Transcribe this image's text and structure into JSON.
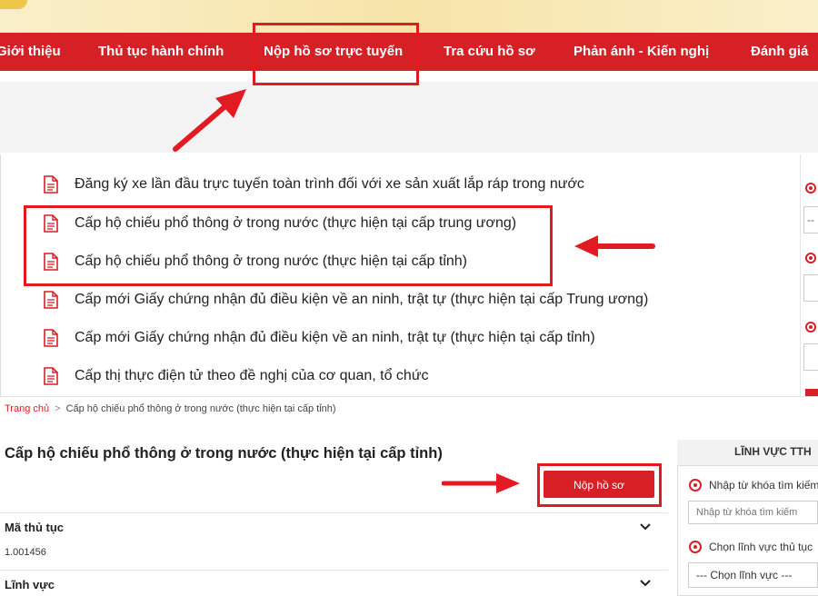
{
  "nav": {
    "items": [
      {
        "label": "Giới thiệu"
      },
      {
        "label": "Thủ tục hành chính"
      },
      {
        "label": "Nộp hồ sơ trực tuyến"
      },
      {
        "label": "Tra cứu hồ sơ"
      },
      {
        "label": "Phản ánh - Kiến nghị"
      },
      {
        "label": "Đánh giá"
      }
    ]
  },
  "procedures": [
    {
      "label": "Đăng ký xe lần đầu trực tuyến toàn trình đối với xe sản xuất lắp ráp trong nước"
    },
    {
      "label": "Cấp hộ chiếu phổ thông ở trong nước (thực hiện tại cấp trung ương)"
    },
    {
      "label": "Cấp hộ chiếu phổ thông ở trong nước (thực hiện tại cấp tỉnh)"
    },
    {
      "label": "Cấp mới Giấy chứng nhận đủ điều kiện về an ninh, trật tự (thực hiện tại cấp Trung ương)"
    },
    {
      "label": "Cấp mới Giấy chứng nhận đủ điều kiện về an ninh, trật tự (thực hiện tại cấp tỉnh)"
    },
    {
      "label": "Cấp thị thực điện tử theo đề nghị của cơ quan, tổ chức"
    }
  ],
  "breadcrumb": {
    "home": "Trang chủ",
    "separator": ">",
    "current": "Cấp hộ chiếu phổ thông ở trong nước (thực hiện tại cấp tỉnh)"
  },
  "detail": {
    "title": "Cấp hộ chiếu phổ thông ở trong nước (thực hiện tại cấp tỉnh)",
    "submit_label": "Nộp hồ sơ",
    "fields": [
      {
        "label": "Mã thủ tục",
        "value": "1.001456"
      },
      {
        "label": "Lĩnh vực",
        "value": ""
      }
    ]
  },
  "sidebar": {
    "heading": "LĨNH VỰC TTH",
    "keyword_option": "Nhập từ khóa tìm kiếm",
    "keyword_placeholder": "Nhập từ khóa tìm kiếm",
    "field_option": "Chọn lĩnh vực thủ tục",
    "field_select": "--- Chọn lĩnh vực ---"
  },
  "right_strip": {
    "select_text": "--"
  },
  "colors": {
    "brand_red": "#d71f26",
    "highlight_red": "#e21b22"
  }
}
